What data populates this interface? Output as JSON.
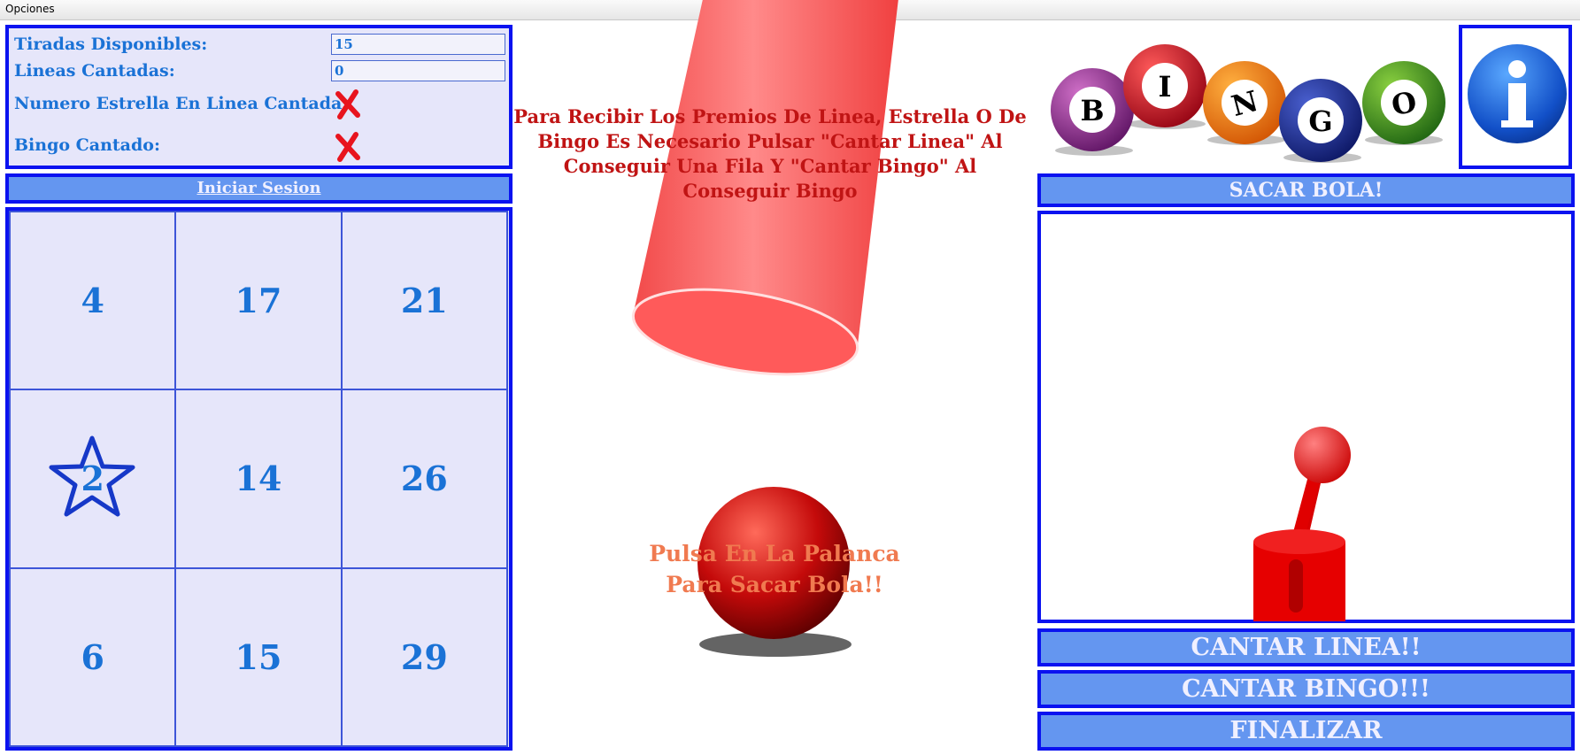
{
  "menu": {
    "label": "Opciones"
  },
  "stats": {
    "tiradas_label": "Tiradas Disponibles:",
    "tiradas_value": "15",
    "lineas_label": "Lineas Cantadas:",
    "lineas_value": "0",
    "estrella_label": "Numero Estrella En Linea Cantada:",
    "estrella_status": "✗",
    "bingo_label": "Bingo Cantado:",
    "bingo_status": "✗"
  },
  "buttons": {
    "login": "Iniciar Sesion",
    "draw": "SACAR BOLA!",
    "line": "CANTAR LINEA!!",
    "bingo": "CANTAR BINGO!!!",
    "finish": "FINALIZAR"
  },
  "card": {
    "numbers": [
      "4",
      "17",
      "21",
      "2",
      "14",
      "26",
      "6",
      "15",
      "29"
    ],
    "star_number": "2"
  },
  "messages": {
    "top": "Para Recibir Los Premios De Linea, Estrella O De Bingo Es Necesario Pulsar \"Cantar Linea\" Al Conseguir Una Fila Y \"Cantar Bingo\" Al Conseguir Bingo",
    "bottom_line1": "Pulsa En La Palanca",
    "bottom_line2": "Para Sacar Bola!!"
  },
  "logo": {
    "letters": [
      "B",
      "I",
      "N",
      "G",
      "O"
    ]
  },
  "colors": {
    "panel_border": "#0a12f0",
    "panel_fill": "#e6e6fa",
    "button_fill": "#6496f0",
    "label_text": "#1a72d6",
    "warning_red": "#c01414",
    "hint_orange": "#f07a50"
  },
  "icons": {
    "info": "info-icon",
    "status": "red-x-icon",
    "star": "star-icon"
  }
}
